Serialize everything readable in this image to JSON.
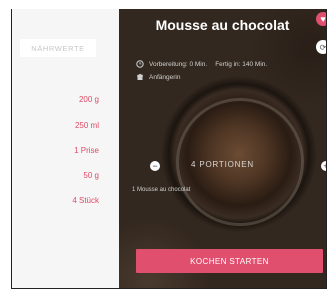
{
  "left_panel": {
    "tab_label": "NÄHRWERTE",
    "ingredients": [
      "200 g",
      "250 ml",
      "1 Prise",
      "50 g",
      "4 Stück"
    ]
  },
  "recipe": {
    "title": "Mousse au chocolat",
    "prep_time": "Vorbereitung: 0 Min.",
    "total_time": "Fertig in: 140 Min.",
    "difficulty": "Anfängerin",
    "portions_label": "4 PORTIONEN",
    "subtitle": "1 Mousse au chocolat",
    "cook_button": "KOCHEN STARTEN"
  },
  "colors": {
    "accent": "#e0506e",
    "dark_bg": "#33281f"
  }
}
